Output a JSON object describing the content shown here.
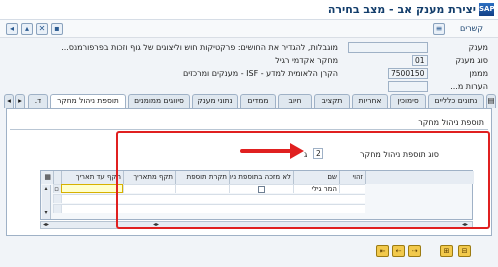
{
  "window": {
    "title": "יצירת מענק אב - מצב בחירה",
    "logo": "SAP"
  },
  "toolbar": {
    "reports_label": "קשרים",
    "icons": [
      "back-icon",
      "exit-icon",
      "cancel-icon",
      "save-icon",
      "reports-icon"
    ]
  },
  "header": {
    "grant_label": "מענק",
    "grant_value": "",
    "grant_description": "מוגבלות, להגדיר את החושים: פרקטיקות חוש וליצוגים של גוף וזכות בפרפורמנס...",
    "grant_type_label": "סוג מענק",
    "grant_type_code": "01",
    "grant_type_text": "מחקר אקדמי רגיל",
    "sponsor_label": "מממן",
    "sponsor_code": "7500150",
    "sponsor_text": "הקרן הלאומית למדע - ISF - מענקים ומרכזים",
    "remarks_label": "הערות מ..."
  },
  "tabs": [
    {
      "label": "נתונים כלליים",
      "active": false
    },
    {
      "label": "סימוכין",
      "active": false
    },
    {
      "label": "אחריות",
      "active": false
    },
    {
      "label": "תקציב",
      "active": false
    },
    {
      "label": "חיוב",
      "active": false
    },
    {
      "label": "ממדים",
      "active": false
    },
    {
      "label": "נתוני מענק",
      "active": false
    },
    {
      "label": "סיווגים ממומנים",
      "active": false
    },
    {
      "label": "תוספת ניהול מחקר",
      "active": true
    },
    {
      "label": "ד.",
      "active": false
    }
  ],
  "tab_scroll": {
    "left": "◂",
    "right": "▸"
  },
  "group": {
    "title": "תוספת ניהול מחקר",
    "supplement_type_label": "סוג תוספת ניהול מחקר",
    "supplement_type_value": "2",
    "supplement_type_suffix": "ג"
  },
  "table": {
    "columns": [
      "זהוי",
      "שם",
      "לא מזכה בתוספת ניהול",
      "תקרת תוספת",
      "תקף מתאריך",
      "תקף עד תאריך"
    ],
    "rows": [
      {
        "id": "",
        "name": "המר גילי",
        "no_supplement": false,
        "ceiling": "",
        "valid_from": "",
        "valid_to": ""
      },
      {
        "id": "",
        "name": "",
        "no_supplement": null,
        "ceiling": "",
        "valid_from": "",
        "valid_to": ""
      },
      {
        "id": "",
        "name": "",
        "no_supplement": null,
        "ceiling": "",
        "valid_from": "",
        "valid_to": ""
      },
      {
        "id": "",
        "name": "",
        "no_supplement": null,
        "ceiling": "",
        "valid_from": "",
        "valid_to": ""
      }
    ]
  },
  "annotation": {
    "arrow_color": "#e02020",
    "frame_color": "#e02020"
  }
}
